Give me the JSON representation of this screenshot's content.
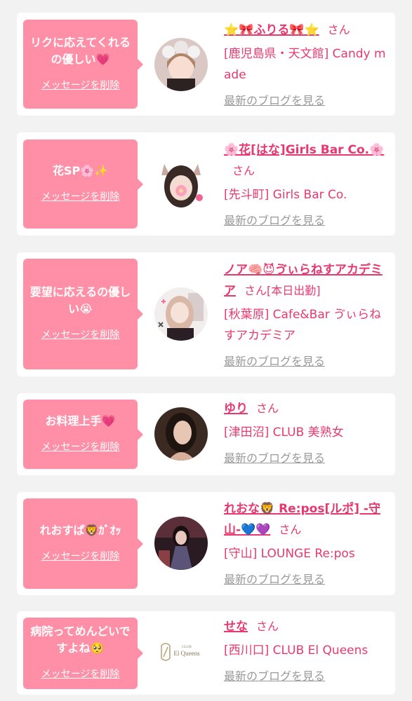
{
  "cards": [
    {
      "message": "リクに応えてくれるの優しい💗",
      "delete_label": "メッセージを削除",
      "name": "⭐🎀ふりる🎀⭐",
      "honorific": "さん",
      "extra": "",
      "shop": "[鹿児島県・天文館] Candy made",
      "blog_label": "最新のブログを見る"
    },
    {
      "message": "花SP🌸✨",
      "delete_label": "メッセージを削除",
      "name": "🌸花[はな]Girls Bar Co.🌸",
      "honorific": "さん",
      "extra": "",
      "shop": "[先斗町] Girls Bar Co.",
      "blog_label": "最新のブログを見る"
    },
    {
      "message": "要望に応えるの優しい😭",
      "delete_label": "メッセージを削除",
      "name": "ノア🧠😈ゔぃらねすアカデミア",
      "honorific": "さん",
      "extra": "[本日出勤]",
      "shop": "[秋葉原] Cafe&Bar ゔぃらねすアカデミア",
      "blog_label": "最新のブログを見る"
    },
    {
      "message": "お料理上手💗",
      "delete_label": "メッセージを削除",
      "name": "ゆり",
      "honorific": "さん",
      "extra": "",
      "shop": "[津田沼] CLUB 美熟女",
      "blog_label": "最新のブログを見る"
    },
    {
      "message": "れおすぱ🦁ｶﾞｵｯ",
      "delete_label": "メッセージを削除",
      "name": "れおな🦁 Re:pos[ルポ] -守山-💙💜",
      "honorific": "さん",
      "extra": "",
      "shop": "[守山] LOUNGE Re:pos",
      "blog_label": "最新のブログを見る"
    },
    {
      "message": "病院ってめんどいですよね🥺",
      "delete_label": "メッセージを削除",
      "name": "せな",
      "honorific": "さん",
      "extra": "",
      "shop": "[西川口] CLUB El Queens",
      "blog_label": "最新のブログを見る",
      "avatar_logo_small": "CLUB",
      "avatar_logo": "El Queens"
    }
  ],
  "colors": {
    "accent": "#e8396e",
    "bubble": "#ff8fa6",
    "muted": "#999999",
    "background": "#f2f2f2"
  }
}
